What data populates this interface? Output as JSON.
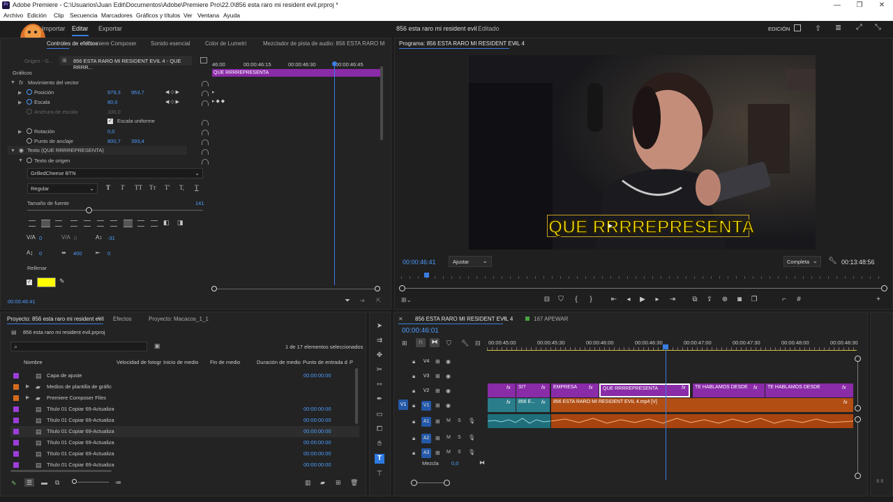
{
  "window": {
    "app_badge": "Pr",
    "title": "Adobe Premiere - C:\\Usuarios\\Juan Edit\\Documentos\\Adobe\\Premiere Pro\\22.0\\856 esta raro mi resident evil.prproj *",
    "minimize": "—",
    "maximize": "❐",
    "close": "✕"
  },
  "menu": [
    "Archivo",
    "Edición",
    "Clip",
    "Secuencia",
    "Marcadores",
    "Gráficos y títulos",
    "Ver",
    "Ventana",
    "Ayuda"
  ],
  "header": {
    "workspaces": [
      "Importar",
      "Editar",
      "Exportar"
    ],
    "active_workspace": "Editar",
    "project_title": "856 esta raro mi resident evil",
    "project_status": "Editado",
    "edition_label": "EDICIÓN"
  },
  "effects_panel": {
    "tabs": [
      "Controles de efectos",
      "Premiere Composer",
      "Sonido esencial",
      "Color de Lumetri",
      "Mezclador de pista de audio: 856 ESTA RARO MI RESIDENT EV..."
    ],
    "source_label": "Origen - G...",
    "sequence_label": "856 ESTA RARO MI RESIDENT EVIL 4 - QUE RRRR...",
    "timeline_times": [
      "46:00",
      "00:00:46:15",
      "00:00:46:30",
      "00:00:46:45"
    ],
    "clip_label": "QUE RRRREPRESENTA",
    "section": "Gráficos",
    "rows": {
      "vector_motion": "Movimiento del vector",
      "position": "Posición",
      "position_x": "979,3",
      "position_y": "953,7",
      "scale": "Escala",
      "scale_value": "80,0",
      "scale_width": "Anchura de escala",
      "scale_width_value": "100,0",
      "uniform_scale": "Escala uniforme",
      "rotation": "Rotación",
      "rotation_value": "0,0",
      "anchor": "Punto de anclaje",
      "anchor_x": "800,7",
      "anchor_y": "393,4",
      "text_layer": "Texto (QUE RRRREPRESENTA)",
      "source_text": "Texto de origen",
      "font": "GrilledCheese BTN",
      "font_style": "Regular",
      "text_styles": [
        "T",
        "T",
        "TT",
        "Tт",
        "T'",
        "T,",
        "T"
      ],
      "font_size_label": "Tamaño de fuente",
      "font_size": "141",
      "kerning": "0",
      "tracking": "0",
      "baseline": "-31",
      "leading": "0",
      "tsume": "400",
      "indent": "0",
      "fill_label": "Rellenar",
      "fill_color": "#ffff00"
    },
    "timecode": "00:00:46:41"
  },
  "program": {
    "title": "Programa: 856 ESTA RARO MI RESIDENT EVIL 4",
    "caption": "QUE RRRREPRESENTA",
    "caption_fill": "#ffe600",
    "timecode": "00:00:46:41",
    "fit": "Ajustar",
    "quality": "Completa",
    "duration": "00:13:48:56",
    "playhead_progress": 0.054
  },
  "project_panel": {
    "tabs": [
      "Proyecto: 856 esta raro mi resident evil",
      "Efectos",
      "Proyecto: Macacos_1_1"
    ],
    "file": "856 esta raro mi resident evil.prproj",
    "selection_count": "1 de 17 elementos seleccionados",
    "columns": [
      "Nombre",
      "Velocidad de fotogr",
      "Inicio de medio",
      "Fin de medio",
      "Duración de medio",
      "Punto de entrada d",
      "P"
    ],
    "items": [
      {
        "name": "Capa de ajuste",
        "in": "00:00:00:00",
        "color": "#9b3ed8",
        "type": "file"
      },
      {
        "name": "Medios de plantilla de gráfic",
        "in": "",
        "color": "#d36b1e",
        "type": "folder"
      },
      {
        "name": "Premiere Composer Files",
        "in": "",
        "color": "#d36b1e",
        "type": "folder"
      },
      {
        "name": "Título 01 Copiar 69-Actualiza",
        "in": "00:00:00:00",
        "color": "#9b3ed8",
        "type": "file"
      },
      {
        "name": "Título 01 Copiar 69-Actualiza",
        "in": "00:00:00:00",
        "color": "#9b3ed8",
        "type": "file"
      },
      {
        "name": "Título 01 Copiar 69-Actualiza",
        "in": "00:00:00:00",
        "color": "#9b3ed8",
        "type": "file"
      },
      {
        "name": "Título 01 Copiar 69-Actualiza",
        "in": "00:00:00:00",
        "color": "#9b3ed8",
        "type": "file"
      },
      {
        "name": "Título 01 Copiar 69-Actualiza",
        "in": "00:00:00:00",
        "color": "#9b3ed8",
        "type": "file"
      },
      {
        "name": "Título 01 Copiar 69-Actualiza",
        "in": "00:00:00:00",
        "color": "#9b3ed8",
        "type": "file"
      }
    ]
  },
  "timeline": {
    "tabs": [
      "856 ESTA RARO MI RESIDENT EVIL 4",
      "167 APEWAR"
    ],
    "timecode": "00:00:46:01",
    "ruler": [
      "00:00:45:00",
      "00:00:45:30",
      "00:00:46:00",
      "00:00:46:30",
      "00:00:47:00",
      "00:00:47:30",
      "00:00:48:00",
      "00:00:48:30"
    ],
    "tracks": [
      "V4",
      "V3",
      "V2",
      "V1",
      "A1",
      "A2",
      "A3"
    ],
    "source_v1": "V1",
    "mix_label": "Mezcla",
    "mix_value": "0,0",
    "v2_clips": [
      "fx",
      "SI?",
      "EMPRESA",
      "QUE RRRREPRESENTA",
      "TE HABLAMOS DESDE",
      "TE HABLAMOS DESDE"
    ],
    "v1_clips": [
      "856 E...",
      "856 ESTA RARO MI RESIDENT EVIL 4.mp4 [V]"
    ],
    "track_letters": {
      "m": "M",
      "s": "S"
    },
    "fx": "fx",
    "vu": "S S"
  }
}
